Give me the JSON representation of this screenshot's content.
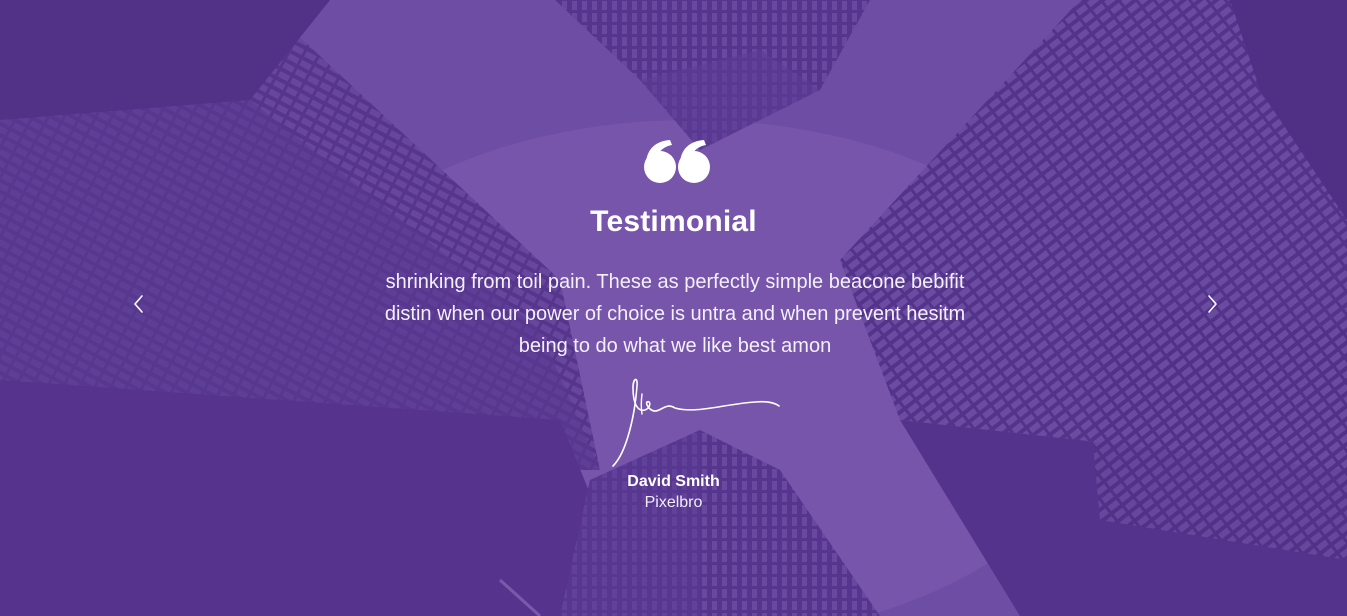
{
  "testimonial": {
    "title": "Testimonial",
    "text": "shrinking from toil pain. These as perfectly simple beacone bebifit distin when our power of choice is untra and when prevent hesitm being to do what we like best amon",
    "author_name": "David Smith",
    "author_company": "Pixelbro"
  },
  "icons": {
    "quote": "quote-icon",
    "signature": "signature-image",
    "prev": "chevron-left-icon",
    "next": "chevron-right-icon"
  },
  "colors": {
    "overlay": "#6a4a9e",
    "text": "#ffffff"
  }
}
